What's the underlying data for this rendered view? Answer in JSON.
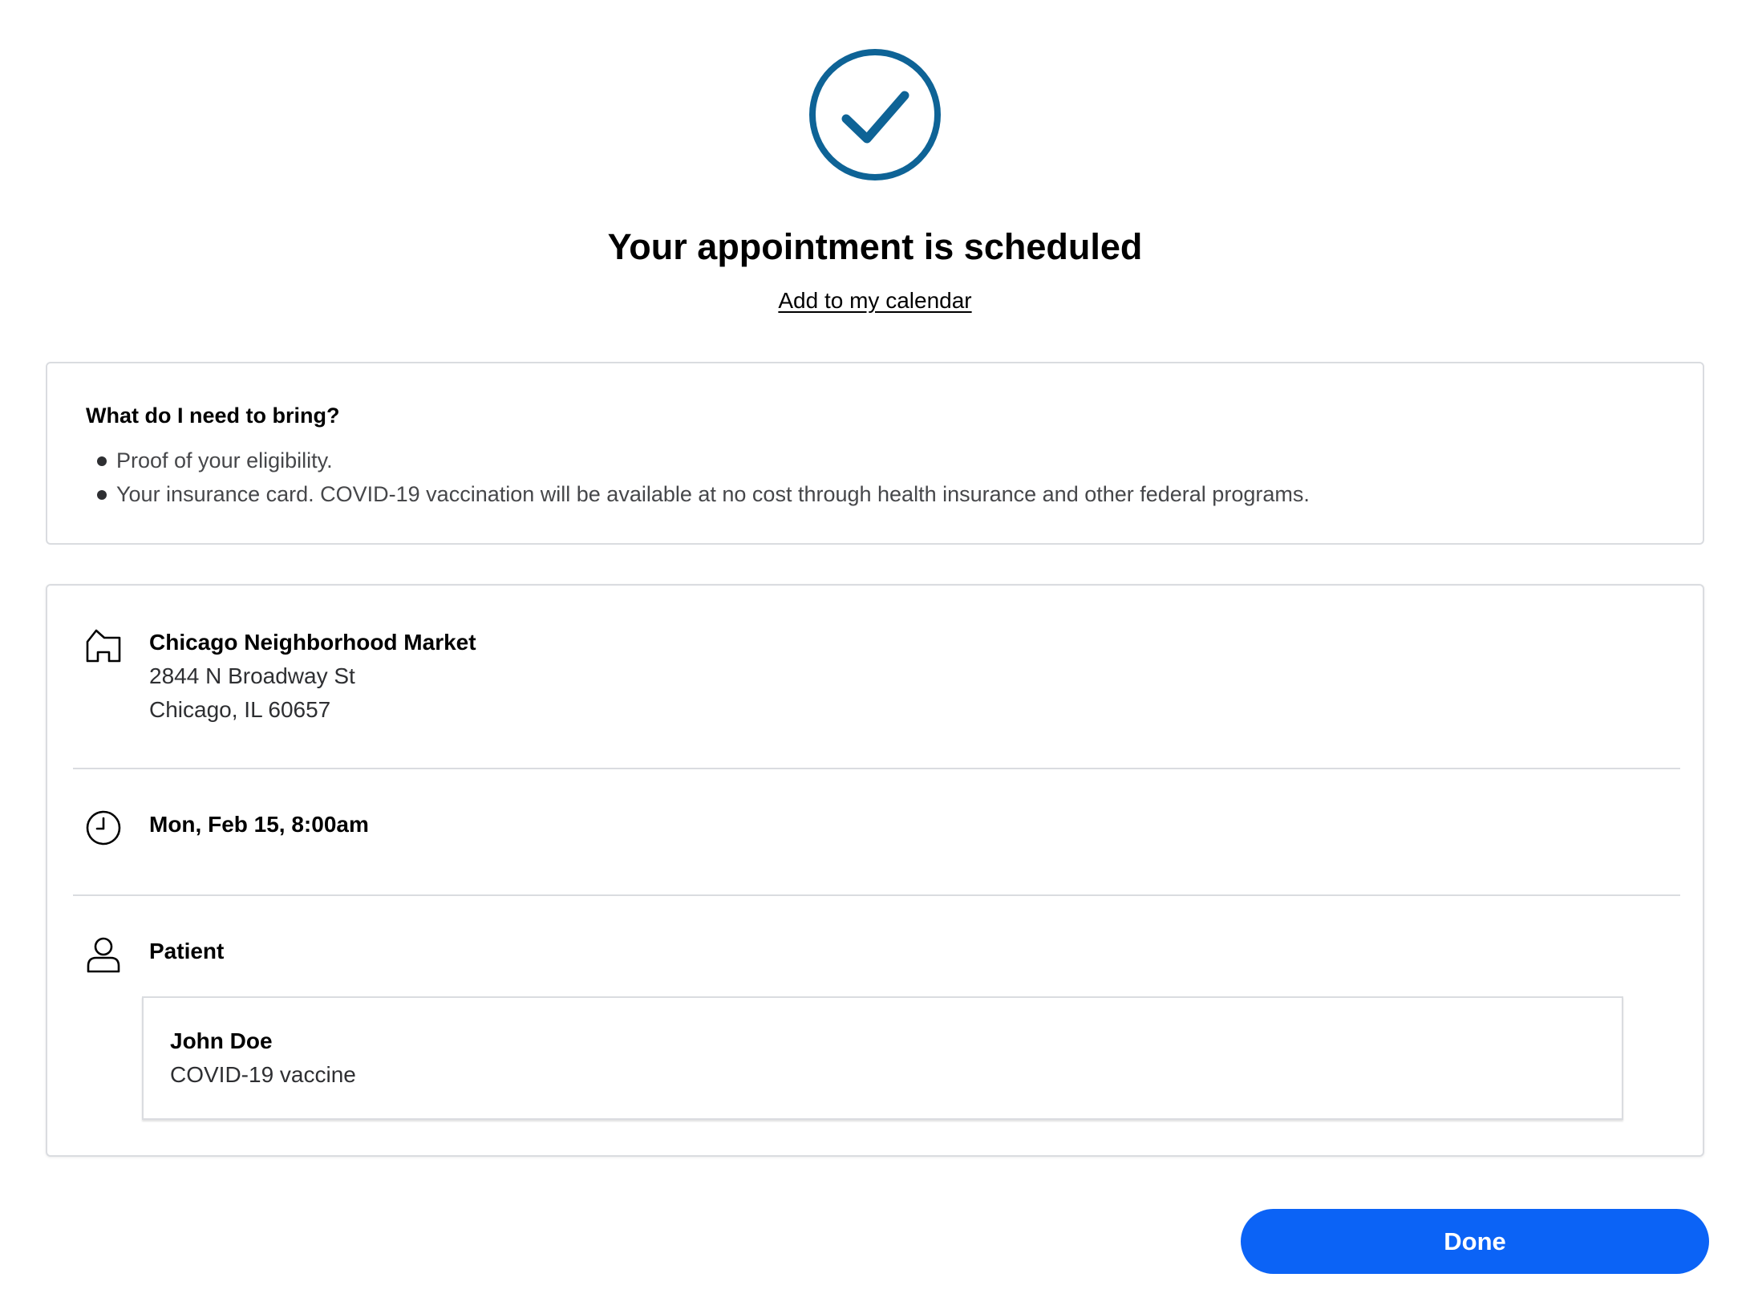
{
  "confirmation": {
    "icon": "check-circle-icon",
    "icon_color": "#0e6396",
    "title": "Your appointment is scheduled",
    "calendar_link": "Add to my calendar"
  },
  "bring": {
    "heading": "What do I need to bring?",
    "items": [
      "Proof of your eligibility.",
      "Your insurance card. COVID-19 vaccination will be available at no cost through health insurance and other federal programs."
    ]
  },
  "location": {
    "icon": "store-icon",
    "name": "Chicago Neighborhood Market",
    "address_line1": "2844 N Broadway St",
    "address_line2": "Chicago, IL 60657"
  },
  "time": {
    "icon": "clock-icon",
    "value": "Mon, Feb 15, 8:00am"
  },
  "patient": {
    "icon": "person-icon",
    "label": "Patient",
    "name": "John Doe",
    "service": "COVID-19 vaccine"
  },
  "actions": {
    "done_label": "Done",
    "done_color": "#0b63f6"
  }
}
